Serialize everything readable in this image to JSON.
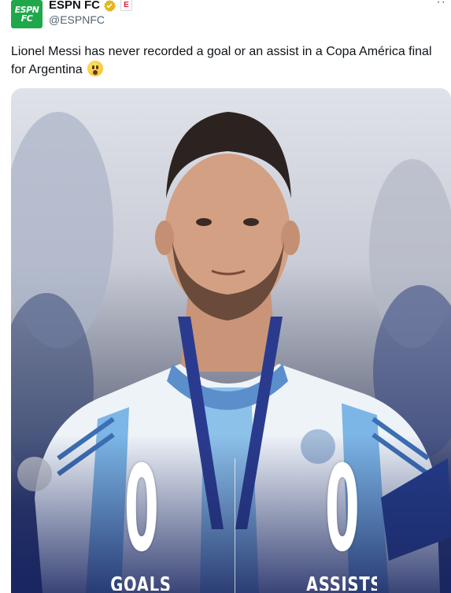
{
  "account": {
    "logo_line1": "ESPN",
    "logo_line2": "FC",
    "name": "ESPN FC",
    "handle": "@ESPNFC",
    "affiliate_badge": "E"
  },
  "more_icon": "more-dots-icon",
  "tweet": {
    "text": "Lionel Messi has never recorded a goal or an assist in a Copa América final for Argentina",
    "emoji": "astonished-face"
  },
  "media": {
    "stats": [
      {
        "value": "0",
        "label": "GOALS"
      },
      {
        "value": "0",
        "label": "ASSISTS"
      }
    ],
    "colors": {
      "jersey_blue": "#7cb6e6",
      "navy": "#1a2660",
      "medal_ribbon": "#2a3b8f"
    }
  }
}
